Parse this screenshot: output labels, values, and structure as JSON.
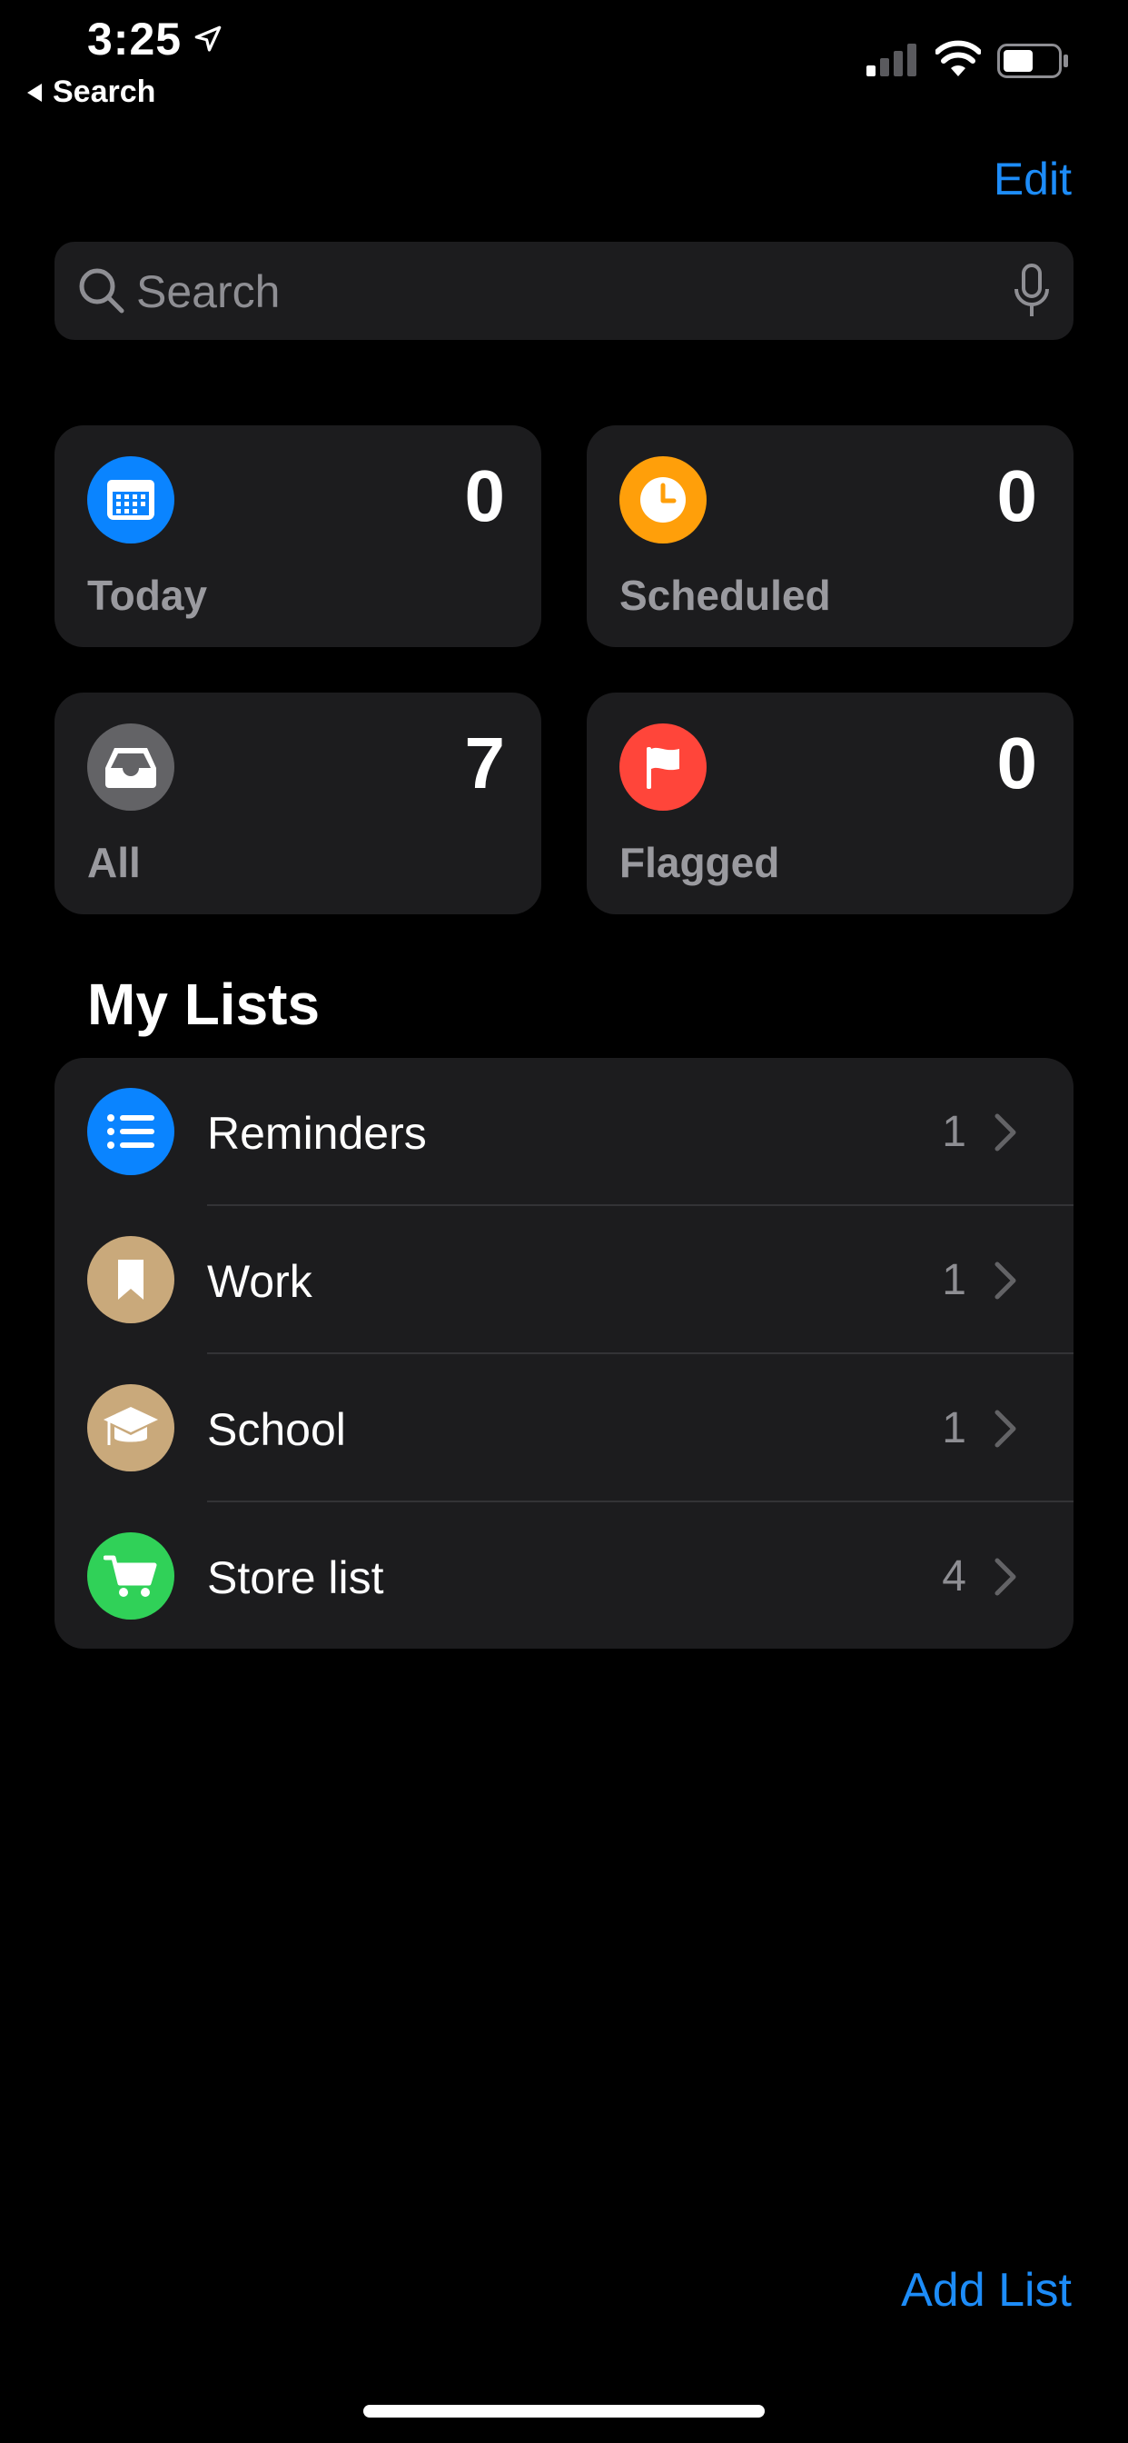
{
  "status_bar": {
    "time": "3:25",
    "back_label": "Search"
  },
  "nav": {
    "edit_label": "Edit"
  },
  "search": {
    "placeholder": "Search"
  },
  "smart_lists": [
    {
      "label": "Today",
      "count": "0",
      "icon": "calendar-icon",
      "color": "#0a84ff"
    },
    {
      "label": "Scheduled",
      "count": "0",
      "icon": "clock-icon",
      "color": "#ff9f0a"
    },
    {
      "label": "All",
      "count": "7",
      "icon": "tray-icon",
      "color": "#636366"
    },
    {
      "label": "Flagged",
      "count": "0",
      "icon": "flag-icon",
      "color": "#ff453a"
    }
  ],
  "my_lists": {
    "title": "My Lists",
    "items": [
      {
        "name": "Reminders",
        "count": "1",
        "icon": "list-bullet-icon",
        "color": "#0a84ff"
      },
      {
        "name": "Work",
        "count": "1",
        "icon": "bookmark-icon",
        "color": "#c9a97b"
      },
      {
        "name": "School",
        "count": "1",
        "icon": "graduation-cap-icon",
        "color": "#c9a97b"
      },
      {
        "name": "Store list",
        "count": "4",
        "icon": "cart-icon",
        "color": "#30d158"
      }
    ]
  },
  "footer": {
    "add_list_label": "Add List"
  }
}
